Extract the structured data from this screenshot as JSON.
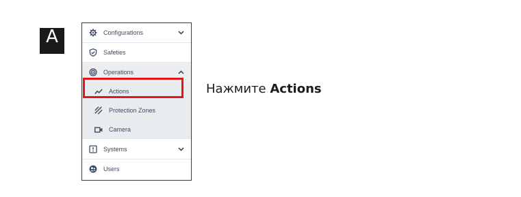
{
  "step": {
    "label": "A"
  },
  "menu": {
    "items": [
      {
        "label": "Configurations",
        "icon": "gear-icon",
        "expanded": false
      },
      {
        "label": "Safeties",
        "icon": "shield-check-icon"
      },
      {
        "label": "Operations",
        "icon": "target-icon",
        "expanded": true
      },
      {
        "label": "Actions",
        "icon": "trend-line-icon",
        "selected": true
      },
      {
        "label": "Protection Zones",
        "icon": "hatched-zone-icon"
      },
      {
        "label": "Camera",
        "icon": "video-camera-icon"
      },
      {
        "label": "Systems",
        "icon": "system-info-icon",
        "expanded": false
      },
      {
        "label": "Users",
        "icon": "users-icon"
      }
    ]
  },
  "instruction": {
    "prefix": "Нажмите ",
    "target": "Actions"
  },
  "colors": {
    "highlight": "#e3141c",
    "menu_text": "#3e4a5c",
    "submenu_bg": "#e9ecef",
    "icon": "#3b4a63"
  }
}
